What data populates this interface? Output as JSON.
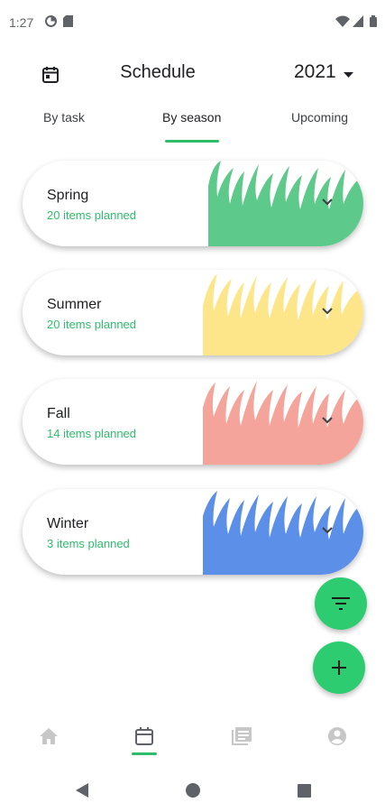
{
  "status_bar": {
    "time": "1:27",
    "icons": [
      "data-saver-icon",
      "sim-card-icon",
      "wifi-icon",
      "signal-icon",
      "battery-icon"
    ]
  },
  "header": {
    "calendar_icon": "calendar-icon",
    "title": "Schedule",
    "year": "2021",
    "year_dropdown_icon": "dropdown-arrow-icon"
  },
  "tabs": [
    {
      "label": "By task",
      "active": false
    },
    {
      "label": "By season",
      "active": true
    },
    {
      "label": "Upcoming",
      "active": false
    }
  ],
  "seasons": [
    {
      "name": "Spring",
      "count": "20 items planned",
      "color": "#5dc98a"
    },
    {
      "name": "Summer",
      "count": "20 items planned",
      "color": "#fde68a"
    },
    {
      "name": "Fall",
      "count": "14 items planned",
      "color": "#f4a49a"
    },
    {
      "name": "Winter",
      "count": "3 items planned",
      "color": "#5b8fe8"
    }
  ],
  "fabs": {
    "filter_icon": "filter-icon",
    "add_icon": "add-icon"
  },
  "bottom_nav": [
    {
      "icon": "home-icon",
      "active": false
    },
    {
      "icon": "calendar-icon",
      "active": true
    },
    {
      "icon": "library-icon",
      "active": false
    },
    {
      "icon": "account-icon",
      "active": false
    }
  ],
  "colors": {
    "accent": "#2ebd6b",
    "fab": "#2ecc71",
    "nav_inactive": "#c7c7c7"
  }
}
